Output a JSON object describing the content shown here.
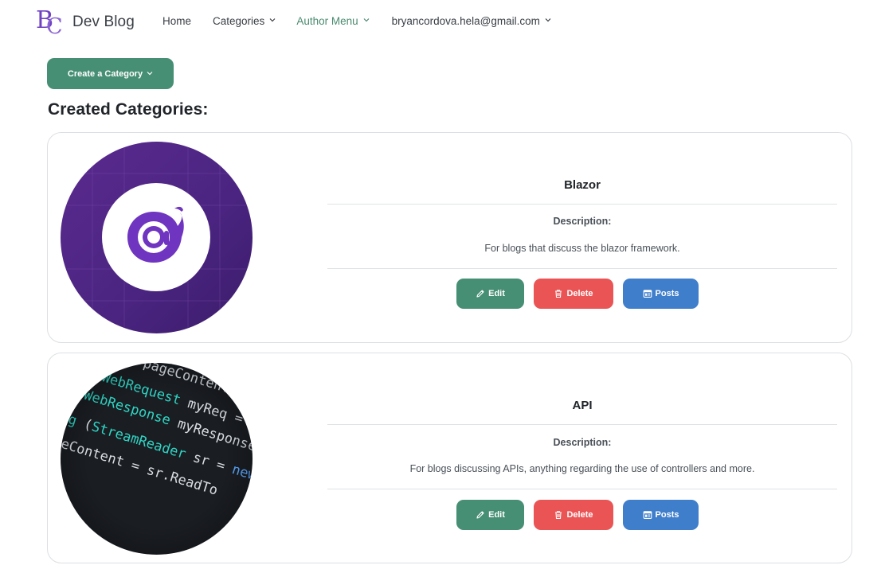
{
  "brand": {
    "logo_letters": "BC",
    "name": "Dev Blog"
  },
  "nav": {
    "home": "Home",
    "categories": "Categories",
    "author_menu": "Author Menu",
    "user_email": "bryancordova.hela@gmail.com"
  },
  "create_button": {
    "label": "Create a Category"
  },
  "section_title": "Created Categories:",
  "categories": [
    {
      "name": "Blazor",
      "description_label": "Description:",
      "description": "For blogs that discuss the blazor framework.",
      "image_icon": "blazor-logo-icon",
      "buttons": {
        "edit": "Edit",
        "delete": "Delete",
        "posts": "Posts"
      }
    },
    {
      "name": "API",
      "description_label": "Description:",
      "description": "For blogs discussing APIs, anything regarding the use of controllers and more.",
      "image_icon": "code-screen-image",
      "buttons": {
        "edit": "Edit",
        "delete": "Delete",
        "posts": "Posts"
      }
    }
  ],
  "colors": {
    "primary_green": "#468f74",
    "active_link": "#4a8a70",
    "danger_red": "#ea5455",
    "info_blue": "#3f7ecb",
    "blazor_purple": "#512bd4"
  }
}
